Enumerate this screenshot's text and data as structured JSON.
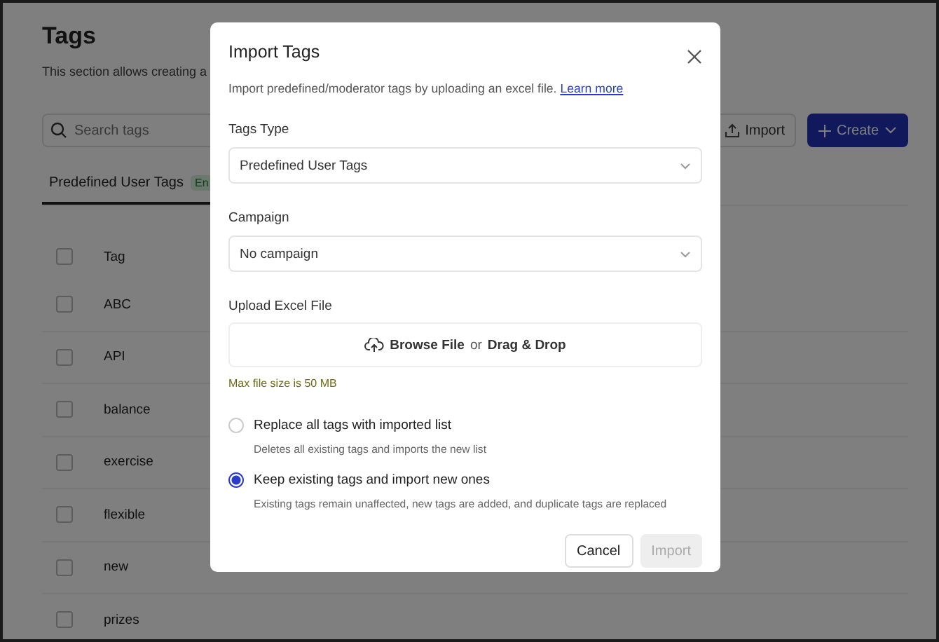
{
  "page": {
    "title": "Tags",
    "description": "This section allows creating a",
    "search": {
      "placeholder": "Search tags"
    },
    "import_button": "Import",
    "create_button": "Create",
    "tabs": [
      {
        "label": "Predefined User Tags",
        "badge": "En",
        "selected": true
      }
    ],
    "table": {
      "header": "Tag",
      "header_checked": false,
      "rows": [
        {
          "tag": "ABC",
          "checked": false
        },
        {
          "tag": "API",
          "checked": false
        },
        {
          "tag": "balance",
          "checked": false
        },
        {
          "tag": "exercise",
          "checked": false
        },
        {
          "tag": "flexible",
          "checked": false
        },
        {
          "tag": "new",
          "checked": false
        },
        {
          "tag": "prizes",
          "checked": false
        }
      ]
    }
  },
  "dialog": {
    "title": "Import Tags",
    "intro": "Import predefined/moderator tags by uploading an excel file.",
    "learn_more": "Learn more",
    "tags_type": {
      "label": "Tags Type",
      "value": "Predefined User Tags"
    },
    "campaign": {
      "label": "Campaign",
      "value": "No campaign"
    },
    "upload": {
      "label": "Upload Excel File",
      "browse": "Browse File",
      "or": "or",
      "drag": "Drag & Drop",
      "hint": "Max file size is 50 MB"
    },
    "options": [
      {
        "label": "Replace all tags with imported list",
        "description": "Deletes all existing tags and imports the new list",
        "selected": false
      },
      {
        "label": "Keep existing tags and import new ones",
        "description": "Existing tags remain unaffected, new tags are added, and duplicate tags are replaced",
        "selected": true
      }
    ],
    "cancel": "Cancel",
    "import": {
      "label": "Import",
      "disabled": true
    }
  }
}
